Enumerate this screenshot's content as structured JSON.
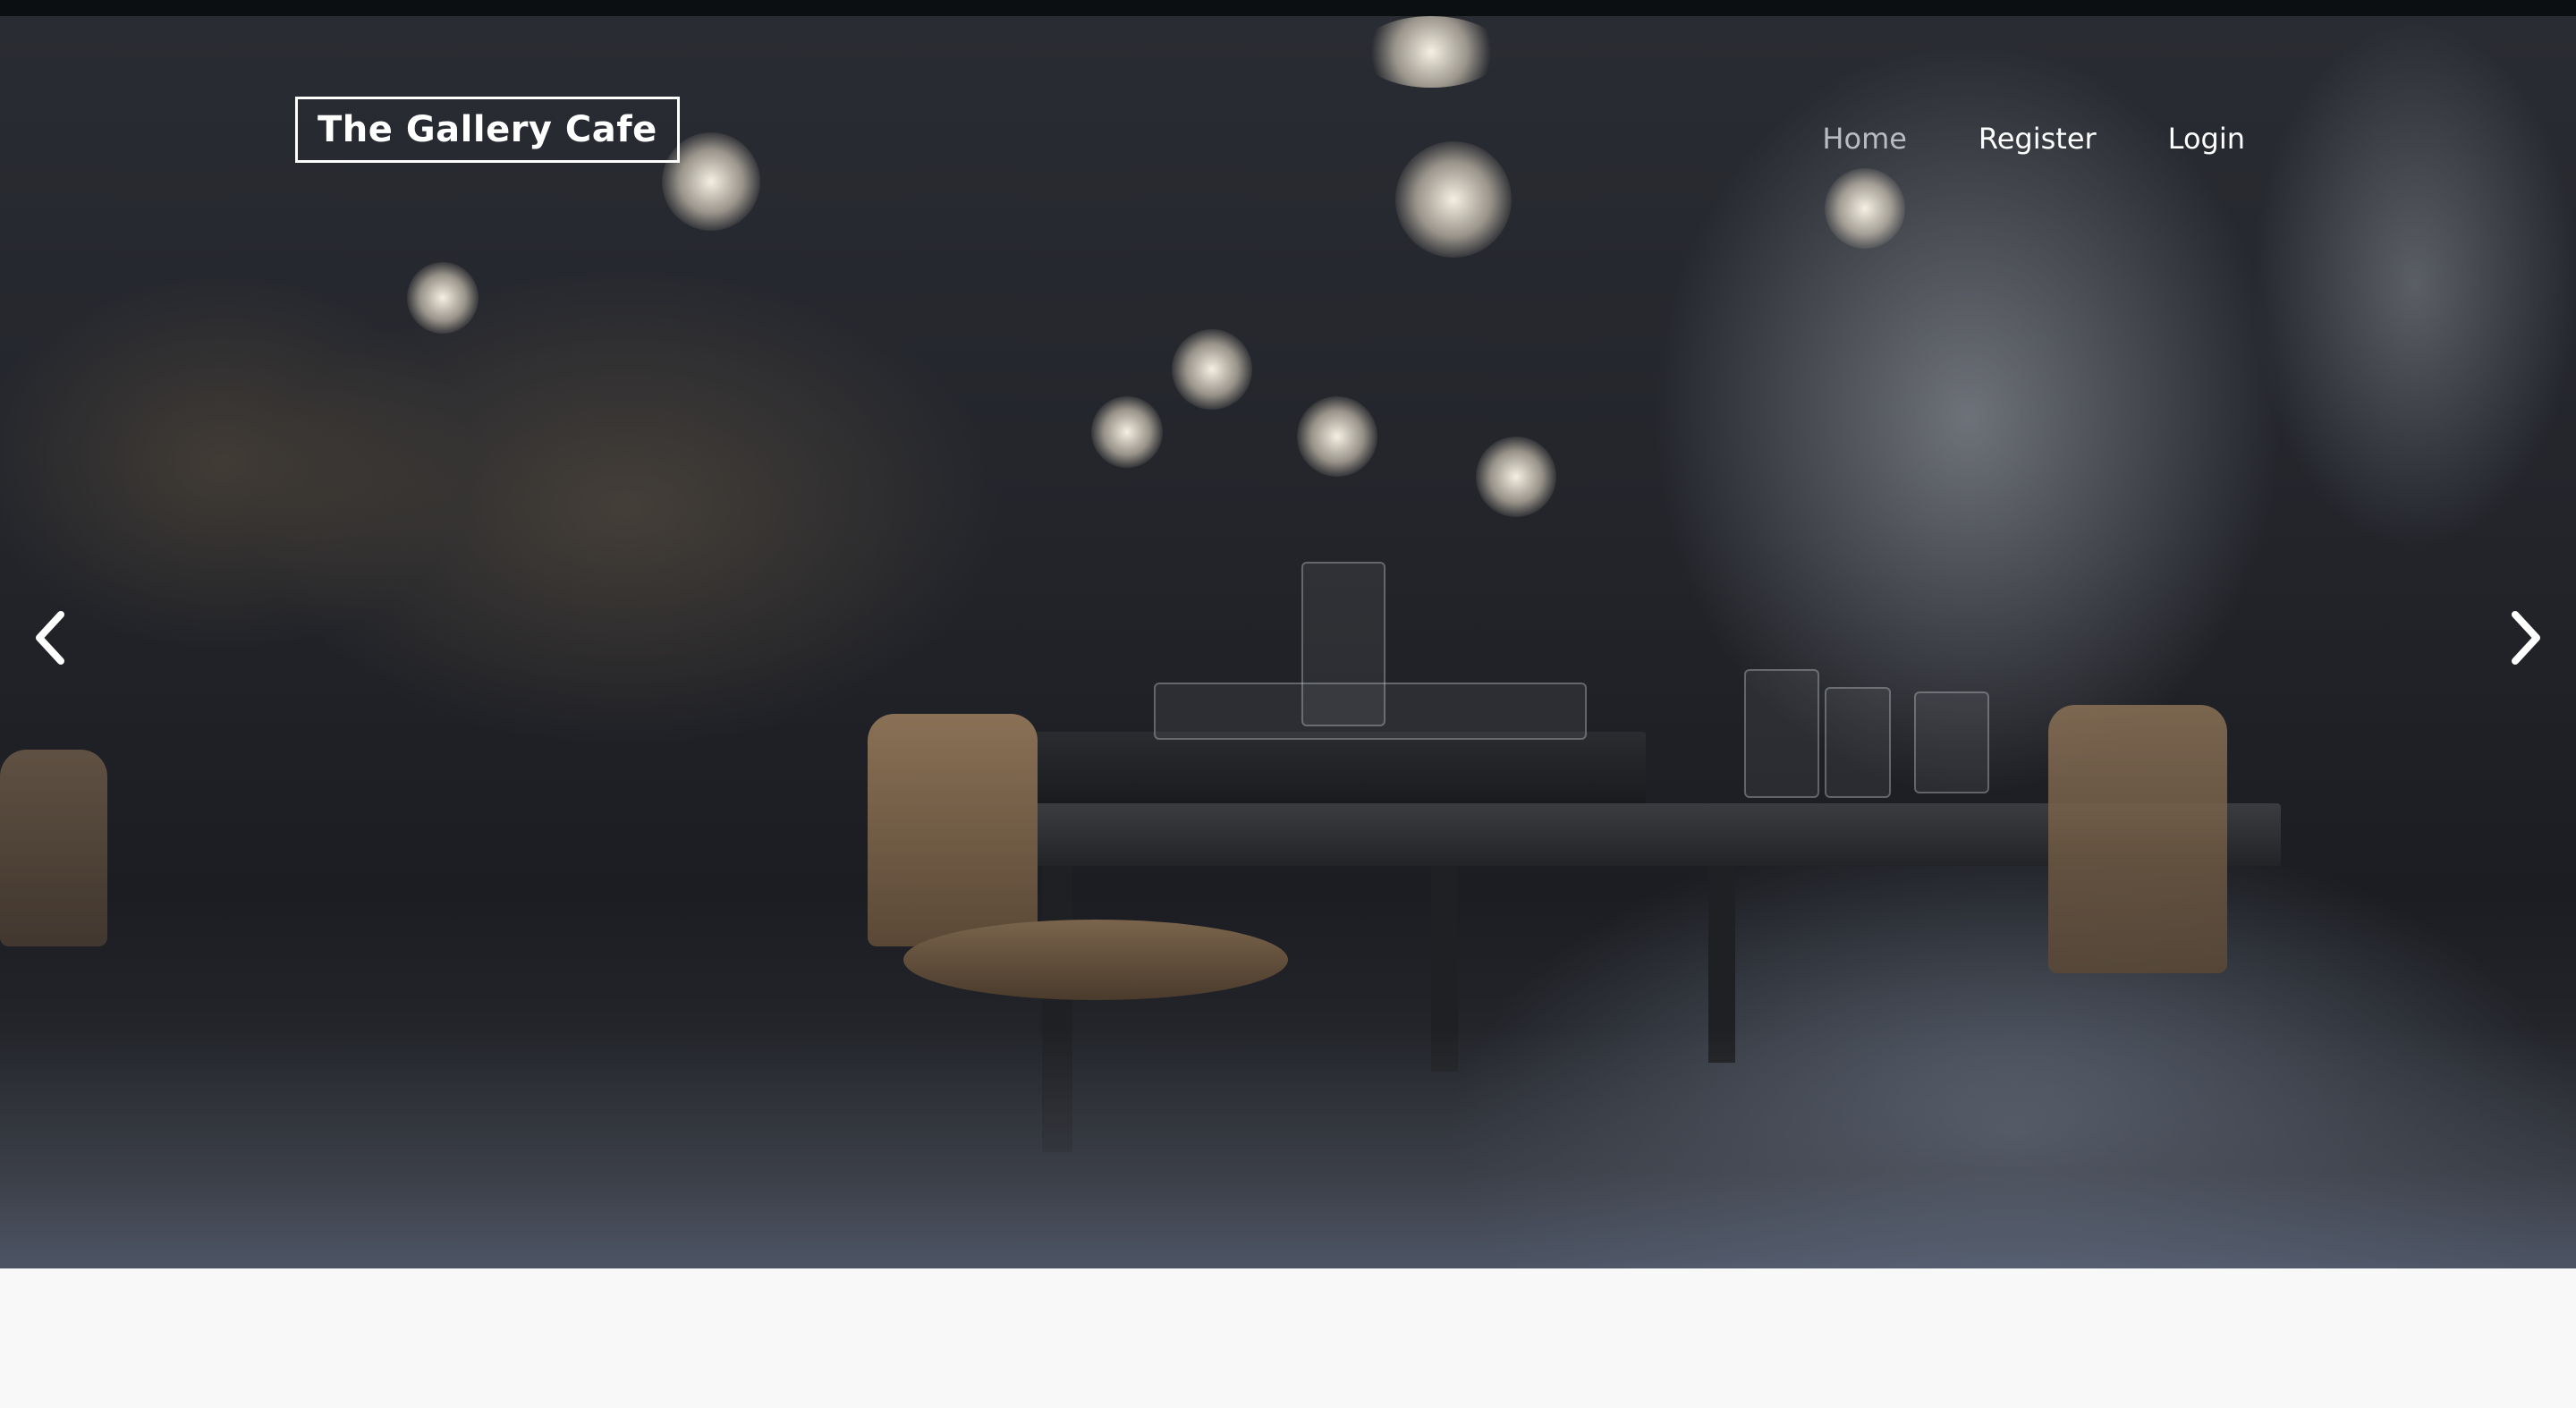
{
  "brand": {
    "logo_text": "The Gallery Cafe"
  },
  "nav": {
    "items": [
      {
        "label": "Home",
        "active": true
      },
      {
        "label": "Register",
        "active": false
      },
      {
        "label": "Login",
        "active": false
      }
    ]
  },
  "carousel": {
    "prev_icon": "chevron-left-icon",
    "next_icon": "chevron-right-icon",
    "slide_image": "cafe-interior-photo"
  },
  "colors": {
    "nav_text": "#ffffff",
    "nav_active": "#b9bcc2",
    "page_background": "#f8f8f8",
    "topbar": "#0b0f12"
  }
}
